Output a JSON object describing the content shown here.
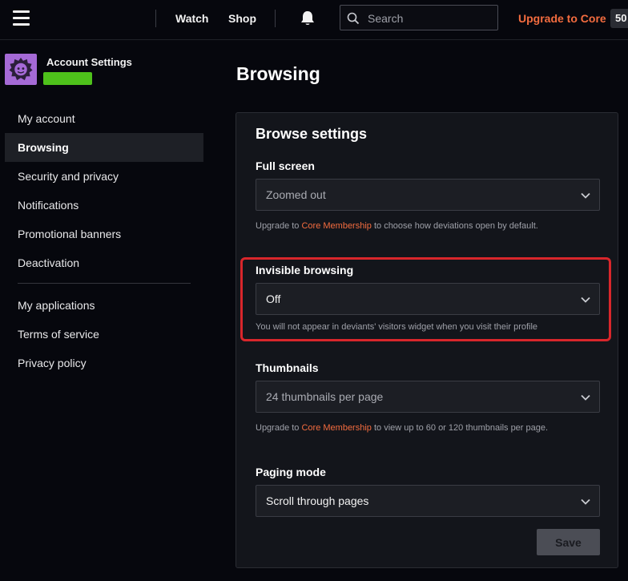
{
  "topbar": {
    "nav": {
      "watch": "Watch",
      "shop": "Shop"
    },
    "search_placeholder": "Search",
    "upgrade_label": "Upgrade to Core",
    "points_label": "50"
  },
  "sidebar": {
    "account_title": "Account Settings",
    "badge_color": "#4ec11b",
    "items": [
      {
        "label": "My account"
      },
      {
        "label": "Browsing",
        "active": true
      },
      {
        "label": "Security and privacy"
      },
      {
        "label": "Notifications"
      },
      {
        "label": "Promotional banners"
      },
      {
        "label": "Deactivation"
      }
    ],
    "secondary_items": [
      {
        "label": "My applications"
      },
      {
        "label": "Terms of service"
      },
      {
        "label": "Privacy policy"
      }
    ]
  },
  "main": {
    "page_title": "Browsing",
    "panel_title": "Browse settings",
    "fields": {
      "full_screen": {
        "label": "Full screen",
        "value": "Zoomed out",
        "help_prefix": "Upgrade to ",
        "help_link": "Core Membership",
        "help_suffix": " to choose how deviations open by default."
      },
      "invisible_browsing": {
        "label": "Invisible browsing",
        "value": "Off",
        "help": "You will not appear in deviants' visitors widget when you visit their profile"
      },
      "thumbnails": {
        "label": "Thumbnails",
        "value": "24 thumbnails per page",
        "help_prefix": "Upgrade to ",
        "help_link": "Core Membership",
        "help_suffix": " to view up to 60 or 120 thumbnails per page."
      },
      "paging_mode": {
        "label": "Paging mode",
        "value": "Scroll through pages"
      }
    },
    "save_label": "Save"
  },
  "colors": {
    "accent": "#f36c3f",
    "highlight_border": "#d8262b",
    "avatar_bg": "#a56ad6"
  }
}
